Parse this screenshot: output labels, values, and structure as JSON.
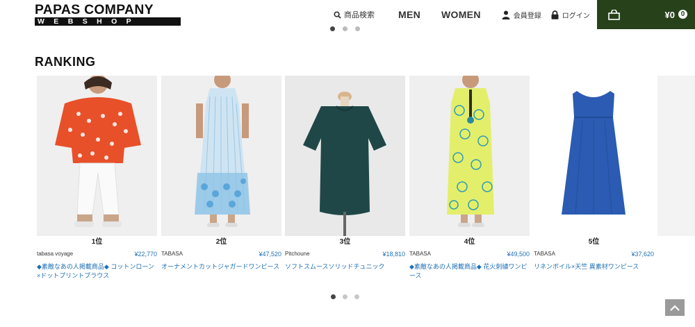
{
  "header": {
    "logo_top": "PAPAS COMPANY",
    "logo_bottom": "WEBSHOP",
    "search_label": "商品検索",
    "nav_men": "MEN",
    "nav_women": "WOMEN",
    "register_label": "会員登録",
    "login_label": "ログイン",
    "cart_total": "¥0",
    "cart_count": "0"
  },
  "section": {
    "title": "RANKING"
  },
  "products": [
    {
      "rank": "1位",
      "brand": "tabasa voyage",
      "price": "¥22,770",
      "name": "◆素敵なあの人掲載商品◆ コットンローン×ドットプリントブラウス",
      "image": "orange-dot-blouse"
    },
    {
      "rank": "2位",
      "brand": "TABASA",
      "price": "¥47,520",
      "name": "オーナメントカットジャガードワンピース",
      "image": "light-blue-dress"
    },
    {
      "rank": "3位",
      "brand": "Pitchoune",
      "price": "¥18,810",
      "name": "ソフトスムースソリッドチュニック",
      "image": "teal-tunic"
    },
    {
      "rank": "4位",
      "brand": "TABASA",
      "price": "¥49,500",
      "name": "◆素敵なあの人掲載商品◆ 花火刺繍ワンピース",
      "image": "yellow-pattern-dress"
    },
    {
      "rank": "5位",
      "brand": "TABASA",
      "price": "¥37,620",
      "name": "リネンボイル×天竺 異素材ワンピース",
      "image": "blue-sleeveless-dress"
    }
  ],
  "colors": {
    "cart_bg": "#27421b",
    "link": "#1e6fb4"
  },
  "icons": [
    "search-icon",
    "user-icon",
    "lock-icon",
    "cart-icon",
    "chevron-up-icon"
  ]
}
